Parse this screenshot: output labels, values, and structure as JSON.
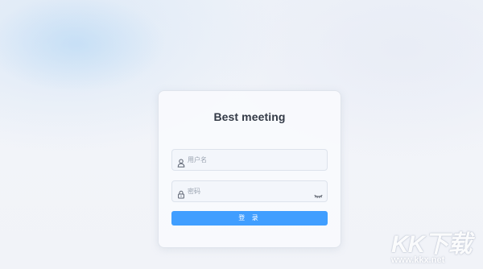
{
  "login": {
    "title": "Best meeting",
    "username_placeholder": "用户名",
    "password_placeholder": "密码",
    "submit_label": "登 录"
  },
  "icons": {
    "username": "user-icon",
    "password": "lock-icon",
    "toggle_password": "eye-closed-icon"
  },
  "watermark": {
    "brand": "KK下载",
    "url": "www.kkx.net"
  },
  "colors": {
    "accent": "#409eff",
    "title": "#333a46",
    "placeholder": "#9aa3b0"
  }
}
